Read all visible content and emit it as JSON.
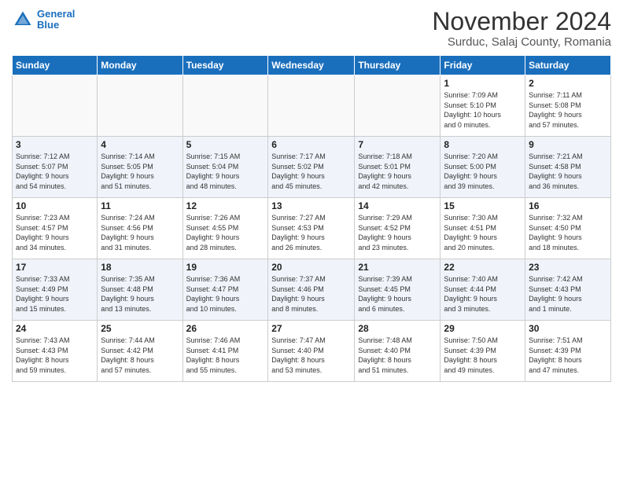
{
  "header": {
    "logo_line1": "General",
    "logo_line2": "Blue",
    "month": "November 2024",
    "location": "Surduc, Salaj County, Romania"
  },
  "weekdays": [
    "Sunday",
    "Monday",
    "Tuesday",
    "Wednesday",
    "Thursday",
    "Friday",
    "Saturday"
  ],
  "weeks": [
    [
      {
        "day": "",
        "info": ""
      },
      {
        "day": "",
        "info": ""
      },
      {
        "day": "",
        "info": ""
      },
      {
        "day": "",
        "info": ""
      },
      {
        "day": "",
        "info": ""
      },
      {
        "day": "1",
        "info": "Sunrise: 7:09 AM\nSunset: 5:10 PM\nDaylight: 10 hours\nand 0 minutes."
      },
      {
        "day": "2",
        "info": "Sunrise: 7:11 AM\nSunset: 5:08 PM\nDaylight: 9 hours\nand 57 minutes."
      }
    ],
    [
      {
        "day": "3",
        "info": "Sunrise: 7:12 AM\nSunset: 5:07 PM\nDaylight: 9 hours\nand 54 minutes."
      },
      {
        "day": "4",
        "info": "Sunrise: 7:14 AM\nSunset: 5:05 PM\nDaylight: 9 hours\nand 51 minutes."
      },
      {
        "day": "5",
        "info": "Sunrise: 7:15 AM\nSunset: 5:04 PM\nDaylight: 9 hours\nand 48 minutes."
      },
      {
        "day": "6",
        "info": "Sunrise: 7:17 AM\nSunset: 5:02 PM\nDaylight: 9 hours\nand 45 minutes."
      },
      {
        "day": "7",
        "info": "Sunrise: 7:18 AM\nSunset: 5:01 PM\nDaylight: 9 hours\nand 42 minutes."
      },
      {
        "day": "8",
        "info": "Sunrise: 7:20 AM\nSunset: 5:00 PM\nDaylight: 9 hours\nand 39 minutes."
      },
      {
        "day": "9",
        "info": "Sunrise: 7:21 AM\nSunset: 4:58 PM\nDaylight: 9 hours\nand 36 minutes."
      }
    ],
    [
      {
        "day": "10",
        "info": "Sunrise: 7:23 AM\nSunset: 4:57 PM\nDaylight: 9 hours\nand 34 minutes."
      },
      {
        "day": "11",
        "info": "Sunrise: 7:24 AM\nSunset: 4:56 PM\nDaylight: 9 hours\nand 31 minutes."
      },
      {
        "day": "12",
        "info": "Sunrise: 7:26 AM\nSunset: 4:55 PM\nDaylight: 9 hours\nand 28 minutes."
      },
      {
        "day": "13",
        "info": "Sunrise: 7:27 AM\nSunset: 4:53 PM\nDaylight: 9 hours\nand 26 minutes."
      },
      {
        "day": "14",
        "info": "Sunrise: 7:29 AM\nSunset: 4:52 PM\nDaylight: 9 hours\nand 23 minutes."
      },
      {
        "day": "15",
        "info": "Sunrise: 7:30 AM\nSunset: 4:51 PM\nDaylight: 9 hours\nand 20 minutes."
      },
      {
        "day": "16",
        "info": "Sunrise: 7:32 AM\nSunset: 4:50 PM\nDaylight: 9 hours\nand 18 minutes."
      }
    ],
    [
      {
        "day": "17",
        "info": "Sunrise: 7:33 AM\nSunset: 4:49 PM\nDaylight: 9 hours\nand 15 minutes."
      },
      {
        "day": "18",
        "info": "Sunrise: 7:35 AM\nSunset: 4:48 PM\nDaylight: 9 hours\nand 13 minutes."
      },
      {
        "day": "19",
        "info": "Sunrise: 7:36 AM\nSunset: 4:47 PM\nDaylight: 9 hours\nand 10 minutes."
      },
      {
        "day": "20",
        "info": "Sunrise: 7:37 AM\nSunset: 4:46 PM\nDaylight: 9 hours\nand 8 minutes."
      },
      {
        "day": "21",
        "info": "Sunrise: 7:39 AM\nSunset: 4:45 PM\nDaylight: 9 hours\nand 6 minutes."
      },
      {
        "day": "22",
        "info": "Sunrise: 7:40 AM\nSunset: 4:44 PM\nDaylight: 9 hours\nand 3 minutes."
      },
      {
        "day": "23",
        "info": "Sunrise: 7:42 AM\nSunset: 4:43 PM\nDaylight: 9 hours\nand 1 minute."
      }
    ],
    [
      {
        "day": "24",
        "info": "Sunrise: 7:43 AM\nSunset: 4:43 PM\nDaylight: 8 hours\nand 59 minutes."
      },
      {
        "day": "25",
        "info": "Sunrise: 7:44 AM\nSunset: 4:42 PM\nDaylight: 8 hours\nand 57 minutes."
      },
      {
        "day": "26",
        "info": "Sunrise: 7:46 AM\nSunset: 4:41 PM\nDaylight: 8 hours\nand 55 minutes."
      },
      {
        "day": "27",
        "info": "Sunrise: 7:47 AM\nSunset: 4:40 PM\nDaylight: 8 hours\nand 53 minutes."
      },
      {
        "day": "28",
        "info": "Sunrise: 7:48 AM\nSunset: 4:40 PM\nDaylight: 8 hours\nand 51 minutes."
      },
      {
        "day": "29",
        "info": "Sunrise: 7:50 AM\nSunset: 4:39 PM\nDaylight: 8 hours\nand 49 minutes."
      },
      {
        "day": "30",
        "info": "Sunrise: 7:51 AM\nSunset: 4:39 PM\nDaylight: 8 hours\nand 47 minutes."
      }
    ]
  ]
}
